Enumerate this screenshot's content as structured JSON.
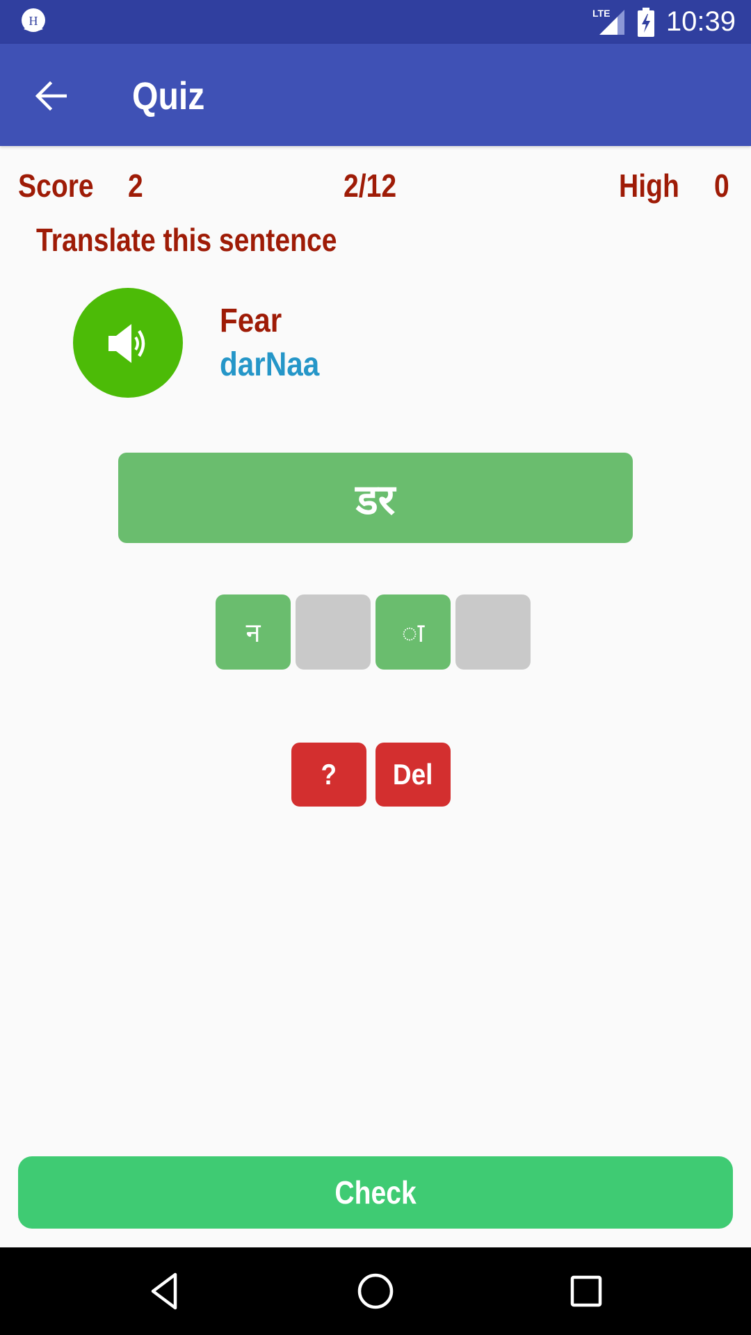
{
  "status_bar": {
    "time": "10:39",
    "network": "LTE",
    "icons": [
      "app-notification-icon",
      "lte-signal-icon",
      "battery-charging-icon"
    ],
    "app_icon_letter": "H"
  },
  "app_bar": {
    "title": "Quiz",
    "back_icon": "arrow-left-icon"
  },
  "scoreboard": {
    "score_label": "Score",
    "score_value": "2",
    "progress": "2/12",
    "high_label": "High",
    "high_value": "0"
  },
  "question": {
    "instruction": "Translate this sentence",
    "speaker_icon": "speaker-icon",
    "english_word": "Fear",
    "transliteration": "darNaa",
    "answer_text": "डर"
  },
  "letter_tiles": [
    {
      "char": "न",
      "state": "filled"
    },
    {
      "char": "",
      "state": "empty"
    },
    {
      "char": "ा",
      "state": "filled"
    },
    {
      "char": "",
      "state": "empty"
    }
  ],
  "actions": {
    "hint_label": "?",
    "delete_label": "Del",
    "check_label": "Check"
  },
  "colors": {
    "status_bar": "#303F9F",
    "app_bar": "#3F51B5",
    "primary_text": "#9E1B06",
    "transliteration_text": "#2596C8",
    "speaker_green": "#4CBB07",
    "tile_green": "#6ABD6E",
    "tile_empty": "#C9C9C9",
    "action_red": "#D32F2F",
    "check_green": "#3FCB73"
  },
  "nav_bar": {
    "buttons": [
      "back-nav",
      "home-nav",
      "recents-nav"
    ]
  }
}
